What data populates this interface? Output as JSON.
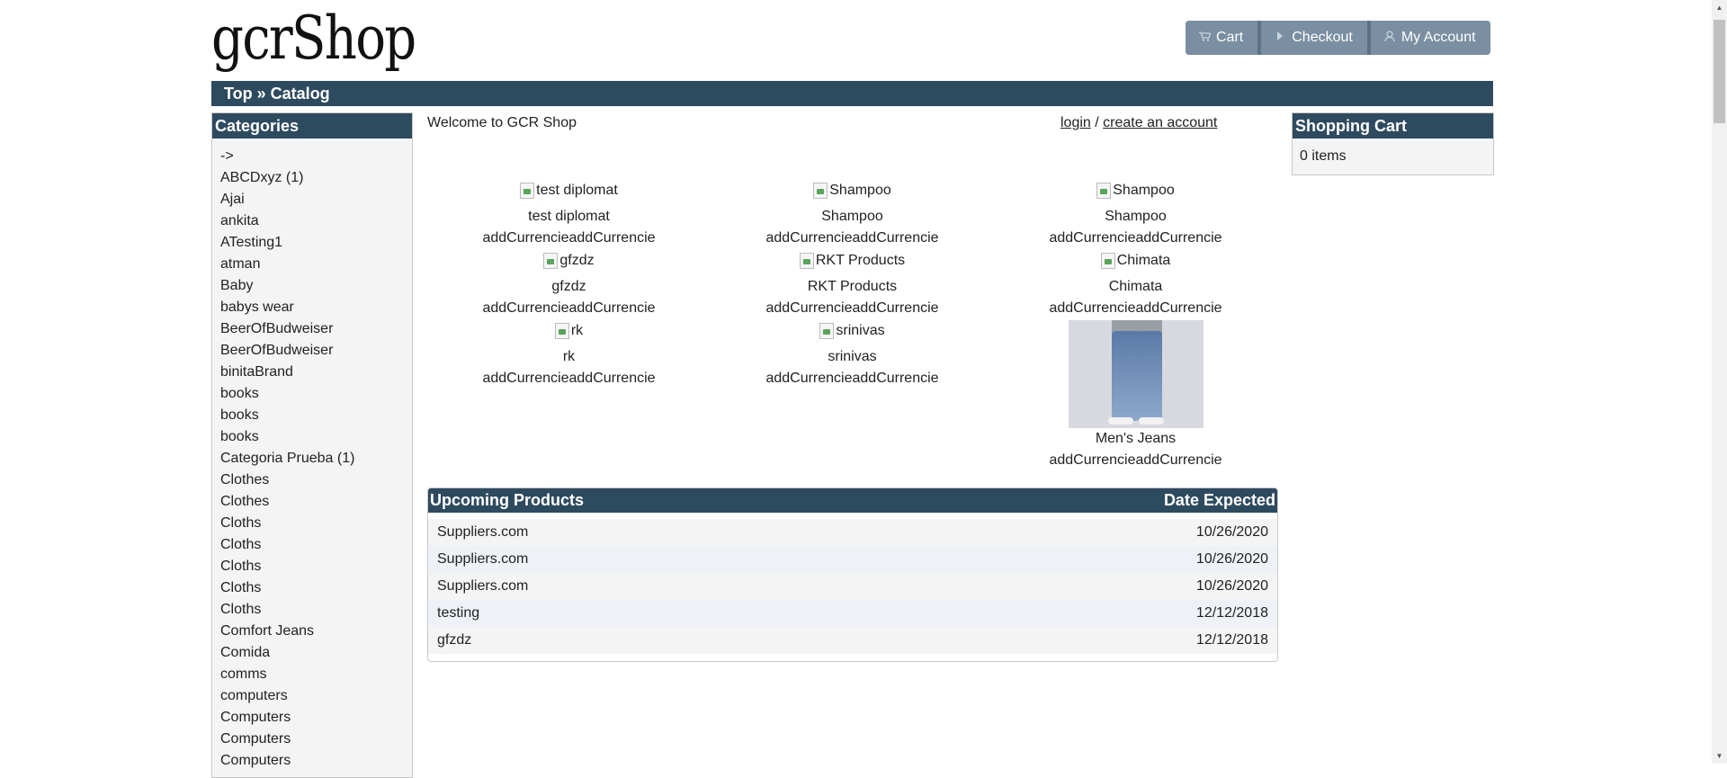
{
  "logo_text": "gcrShop",
  "header_nav": [
    {
      "label": "Cart",
      "icon": "cart-icon"
    },
    {
      "label": "Checkout",
      "icon": "triangle-right-icon"
    },
    {
      "label": "My Account",
      "icon": "user-icon"
    }
  ],
  "breadcrumb": {
    "top": "Top",
    "separator": " » ",
    "current": "Catalog"
  },
  "categories": {
    "title": "Categories",
    "items": [
      "->",
      "ABCDxyz (1)",
      "Ajai",
      "ankita",
      "ATesting1",
      "atman",
      "Baby",
      "babys wear",
      "BeerOfBudweiser",
      "BeerOfBudweiser",
      "binitaBrand",
      "books",
      "books",
      "books",
      "Categoria Prueba (1)",
      "Clothes",
      "Clothes",
      "Cloths",
      "Cloths",
      "Cloths",
      "Cloths",
      "Cloths",
      "Comfort Jeans",
      "Comida",
      "comms",
      "computers",
      "Computers",
      "Computers",
      "Computers"
    ]
  },
  "welcome": "Welcome to GCR Shop",
  "account_links": {
    "login": "login",
    "separator": " / ",
    "create": "create an account"
  },
  "products": [
    {
      "image_alt": "test diplomat",
      "name": "test diplomat",
      "price": "addCurrencieaddCurrencie"
    },
    {
      "image_alt": "Shampoo",
      "name": "Shampoo",
      "price": "addCurrencieaddCurrencie"
    },
    {
      "image_alt": "Shampoo",
      "name": "Shampoo",
      "price": "addCurrencieaddCurrencie"
    },
    {
      "image_alt": "gfzdz",
      "name": "gfzdz",
      "price": "addCurrencieaddCurrencie"
    },
    {
      "image_alt": "RKT Products",
      "name": "RKT Products",
      "price": "addCurrencieaddCurrencie"
    },
    {
      "image_alt": "Chimata",
      "name": "Chimata",
      "price": "addCurrencieaddCurrencie"
    },
    {
      "image_alt": "rk",
      "name": "rk",
      "price": "addCurrencieaddCurrencie"
    },
    {
      "image_alt": "srinivas",
      "name": "srinivas",
      "price": "addCurrencieaddCurrencie"
    },
    {
      "image_alt": "",
      "name": "Men's Jeans",
      "price": "addCurrencieaddCurrencie"
    }
  ],
  "upcoming": {
    "title": "Upcoming Products",
    "date_header": "Date Expected",
    "rows": [
      {
        "name": "Suppliers.com",
        "date": "10/26/2020"
      },
      {
        "name": "Suppliers.com",
        "date": "10/26/2020"
      },
      {
        "name": "Suppliers.com",
        "date": "10/26/2020"
      },
      {
        "name": "testing",
        "date": "12/12/2018"
      },
      {
        "name": "gfzdz",
        "date": "12/12/2018"
      }
    ]
  },
  "cart": {
    "title": "Shopping Cart",
    "content": "0 items"
  },
  "colors": {
    "header_bar": "#2e4a5f",
    "nav_button": "#7a8fa1",
    "panel_bg": "#f4f4f4"
  }
}
